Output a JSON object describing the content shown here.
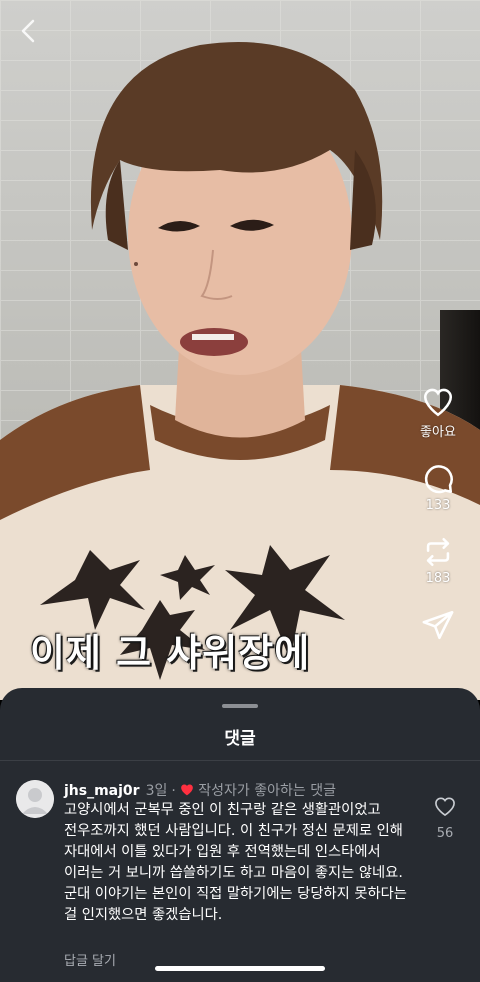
{
  "video": {
    "subtitle": "이제 그 샤워장에"
  },
  "actions": {
    "like_label": "좋아요",
    "comment_count": "133",
    "repost_count": "183"
  },
  "sheet": {
    "title": "댓글"
  },
  "comment": {
    "username": "jhs_maj0r",
    "time": "3일",
    "separator": "·",
    "liked_by_author": "작성자가 좋아하는 댓글",
    "text": "고양시에서 군복무 중인 이 친구랑 같은 생활관이었고 전우조까지 했던 사람입니다. 이 친구가 정신 문제로 인해 자대에서 이틀 있다가 입원 후 전역했는데 인스타에서 이러는 거 보니까 씁쓸하기도 하고 마음이 좋지는 않네요. 군대 이야기는 본인이 직접 말하기에는 당당하지 못하다는 걸 인지했으면 좋겠습니다.",
    "reply_label": "답글 달기",
    "like_count": "56"
  },
  "colors": {
    "sheet_bg": "#272b31",
    "heart_red": "#ff3040",
    "muted_text": "#9a9ea4"
  },
  "icons": [
    "back-chevron-icon",
    "heart-icon",
    "comment-icon",
    "repost-icon",
    "send-icon",
    "avatar-placeholder-icon"
  ]
}
